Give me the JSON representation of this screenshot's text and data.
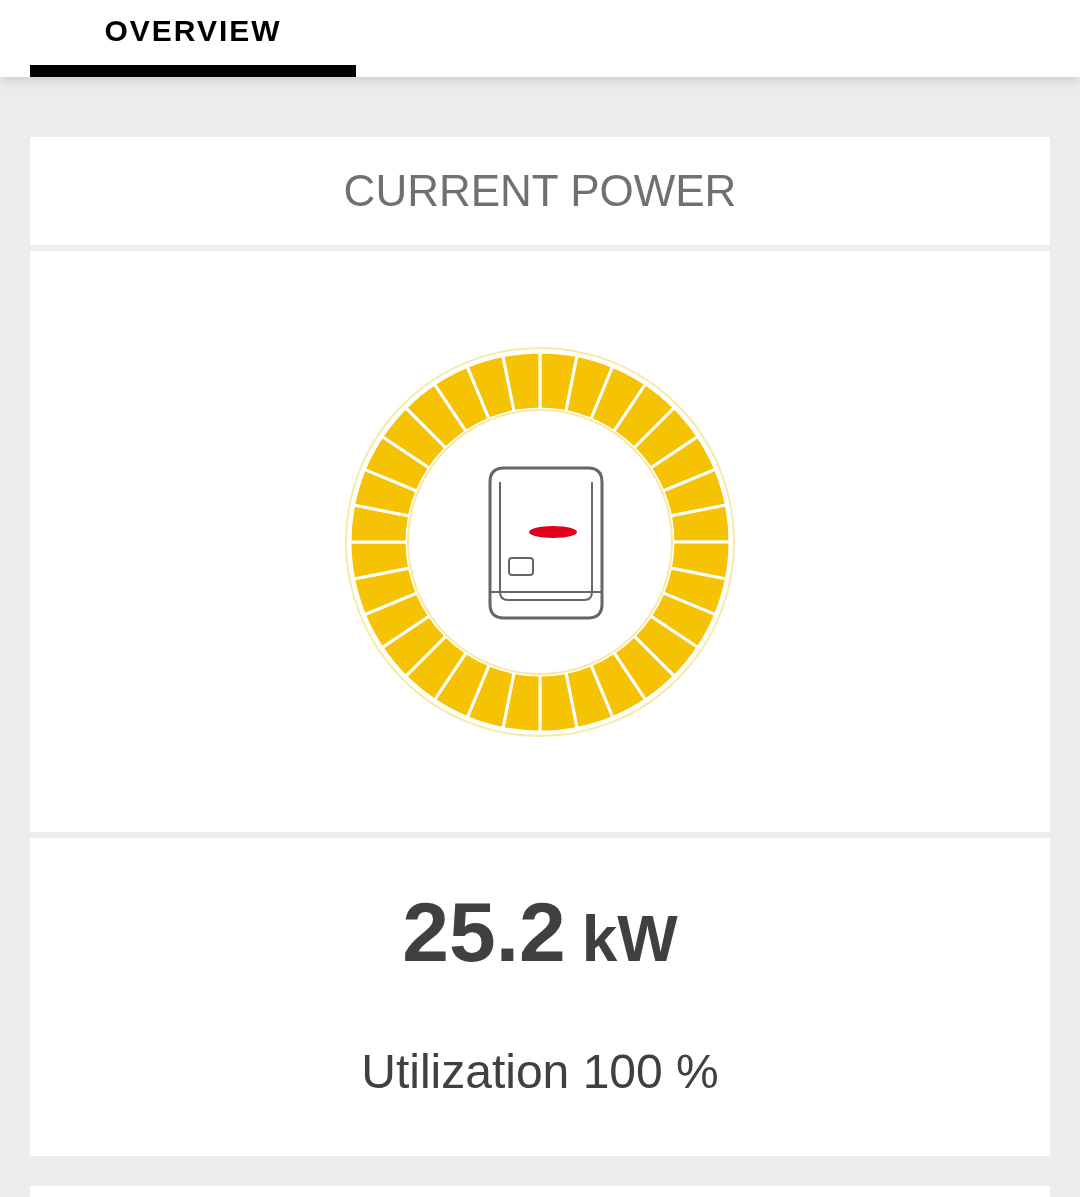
{
  "tabs": [
    {
      "label": "OVERVIEW",
      "selected": true
    }
  ],
  "card": {
    "title": "CURRENT POWER",
    "value": "25.2",
    "unit": "kW",
    "utilization": "Utilization 100 %"
  }
}
